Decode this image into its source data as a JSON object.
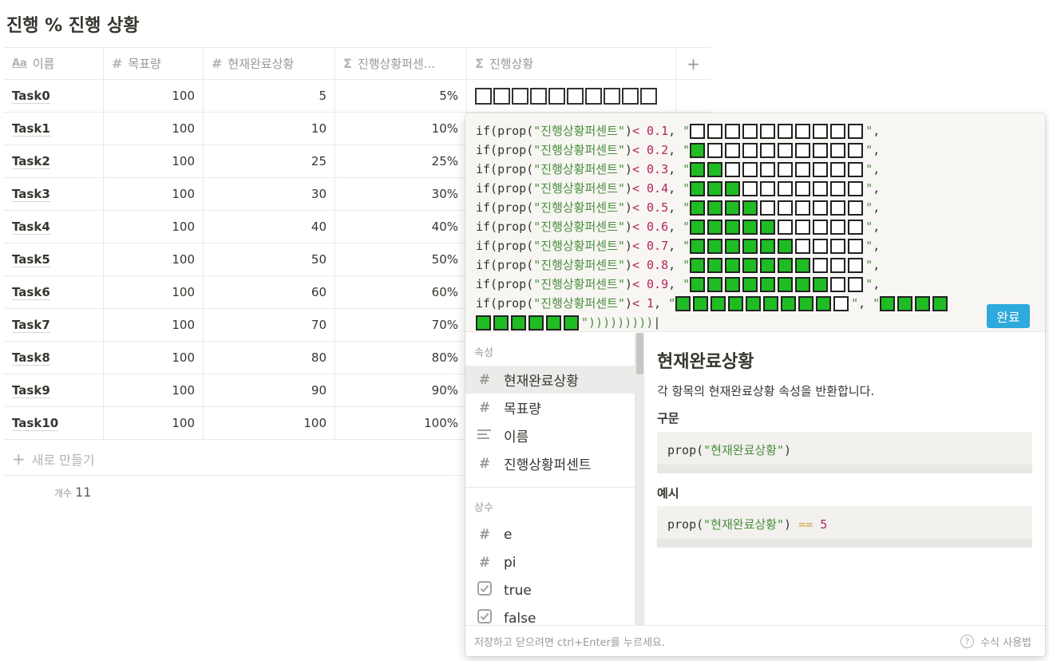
{
  "page": {
    "title": "진행 % 진행 상황"
  },
  "table": {
    "headers": {
      "name": "이름",
      "goal": "목표량",
      "current": "현재완료상황",
      "percent": "진행상황퍼센...",
      "progress": "진행상황",
      "add": "+"
    },
    "rows": [
      {
        "name": "Task0",
        "goal": "100",
        "current": "5",
        "percent": "5%"
      },
      {
        "name": "Task1",
        "goal": "100",
        "current": "10",
        "percent": "10%"
      },
      {
        "name": "Task2",
        "goal": "100",
        "current": "25",
        "percent": "25%"
      },
      {
        "name": "Task3",
        "goal": "100",
        "current": "30",
        "percent": "30%"
      },
      {
        "name": "Task4",
        "goal": "100",
        "current": "40",
        "percent": "40%"
      },
      {
        "name": "Task5",
        "goal": "100",
        "current": "50",
        "percent": "50%"
      },
      {
        "name": "Task6",
        "goal": "100",
        "current": "60",
        "percent": "60%"
      },
      {
        "name": "Task7",
        "goal": "100",
        "current": "70",
        "percent": "70%"
      },
      {
        "name": "Task8",
        "goal": "100",
        "current": "80",
        "percent": "80%"
      },
      {
        "name": "Task9",
        "goal": "100",
        "current": "90",
        "percent": "90%"
      },
      {
        "name": "Task10",
        "goal": "100",
        "current": "100",
        "percent": "100%"
      }
    ],
    "new_row_label": "새로 만들기",
    "count_label": "개수",
    "count_value": "11"
  },
  "formula": {
    "lines": [
      {
        "pre": "if(prop(",
        "prop": "\"진행상황퍼센트\"",
        "mid": ") ",
        "op": "<",
        "num": "0.1",
        "filled": 0,
        "boxes": 10
      },
      {
        "pre": "if(prop(",
        "prop": "\"진행상황퍼센트\"",
        "mid": ") ",
        "op": "<",
        "num": "0.2",
        "filled": 1,
        "boxes": 10
      },
      {
        "pre": "if(prop(",
        "prop": "\"진행상황퍼센트\"",
        "mid": ") ",
        "op": "<",
        "num": "0.3",
        "filled": 2,
        "boxes": 10
      },
      {
        "pre": "if(prop(",
        "prop": "\"진행상황퍼센트\"",
        "mid": ") ",
        "op": "<",
        "num": "0.4",
        "filled": 3,
        "boxes": 10
      },
      {
        "pre": "if(prop(",
        "prop": "\"진행상황퍼센트\"",
        "mid": ") ",
        "op": "<",
        "num": "0.5",
        "filled": 4,
        "boxes": 10
      },
      {
        "pre": "if(prop(",
        "prop": "\"진행상황퍼센트\"",
        "mid": ") ",
        "op": "<",
        "num": "0.6",
        "filled": 5,
        "boxes": 10
      },
      {
        "pre": "if(prop(",
        "prop": "\"진행상황퍼센트\"",
        "mid": ") ",
        "op": "<",
        "num": "0.7",
        "filled": 6,
        "boxes": 10
      },
      {
        "pre": "if(prop(",
        "prop": "\"진행상황퍼센트\"",
        "mid": ") ",
        "op": "<",
        "num": "0.8",
        "filled": 7,
        "boxes": 10
      },
      {
        "pre": "if(prop(",
        "prop": "\"진행상황퍼센트\"",
        "mid": ") ",
        "op": "<",
        "num": "0.9",
        "filled": 8,
        "boxes": 10
      }
    ],
    "last_line": {
      "pre": "if(prop(",
      "prop": "\"진행상황퍼센트\"",
      "mid": ") ",
      "op": "<",
      "num": "1",
      "filled": 9,
      "boxes": 10,
      "else_filled_first": 4,
      "else_filled_second": 6,
      "closing": "\")))))))))"
    },
    "done_label": "완료"
  },
  "sidebar": {
    "properties_label": "속성",
    "properties": [
      {
        "label": "현재완료상황",
        "icon": "hash-icon",
        "active": true
      },
      {
        "label": "목표량",
        "icon": "hash-icon"
      },
      {
        "label": "이름",
        "icon": "text-icon"
      },
      {
        "label": "진행상황퍼센트",
        "icon": "hash-icon"
      }
    ],
    "constants_label": "상수",
    "constants": [
      {
        "label": "e",
        "icon": "hash-icon"
      },
      {
        "label": "pi",
        "icon": "hash-icon"
      },
      {
        "label": "true",
        "icon": "checkbox-icon"
      },
      {
        "label": "false",
        "icon": "checkbox-icon"
      }
    ]
  },
  "detail": {
    "title": "현재완료상황",
    "description": "각 항목의 현재완료상황 속성을 반환합니다.",
    "syntax_label": "구문",
    "syntax_code_fn": "prop(",
    "syntax_code_str": "\"현재완료상황\"",
    "syntax_code_end": ")",
    "example_label": "예시",
    "example_code_fn": "prop(",
    "example_code_str": "\"현재완료상황\"",
    "example_code_end": ") ",
    "example_code_op": "==",
    "example_code_num": "5"
  },
  "footer": {
    "hint": "저장하고 닫으려면 ctrl+Enter를 누르세요.",
    "help_label": "수식 사용법"
  }
}
